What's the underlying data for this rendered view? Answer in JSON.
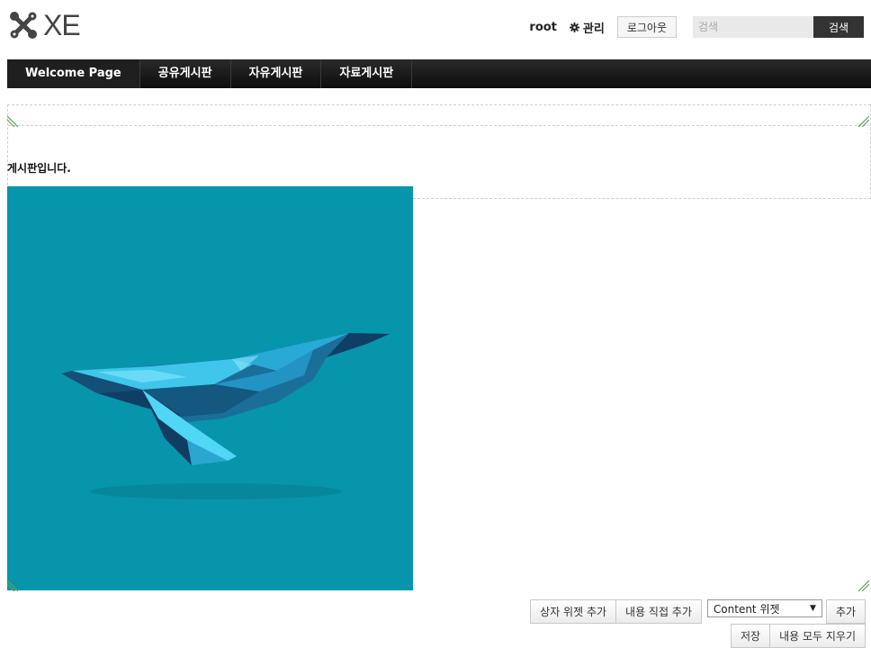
{
  "header": {
    "logo_text": "XE",
    "user_name": "root",
    "admin_label": "관리",
    "logout_label": "로그아웃",
    "search_placeholder": "검색",
    "search_button": "검색"
  },
  "nav": {
    "items": [
      {
        "label": "Welcome Page"
      },
      {
        "label": "공유게시판"
      },
      {
        "label": "자유게시판"
      },
      {
        "label": "자료게시판"
      }
    ]
  },
  "content": {
    "board_title": "게시판입니다."
  },
  "controls": {
    "add_box_widget": "상자 위젯 추가",
    "add_direct_content": "내용 직접 추가",
    "widget_select_value": "Content 위젯",
    "add_button": "추가",
    "save_button": "저장",
    "clear_all_button": "내용 모두 지우기"
  },
  "colors": {
    "nav_bg": "#111111",
    "panel_bg": "#0795ac",
    "search_button_bg": "#333333",
    "resize_mark": "#5aa55a"
  }
}
